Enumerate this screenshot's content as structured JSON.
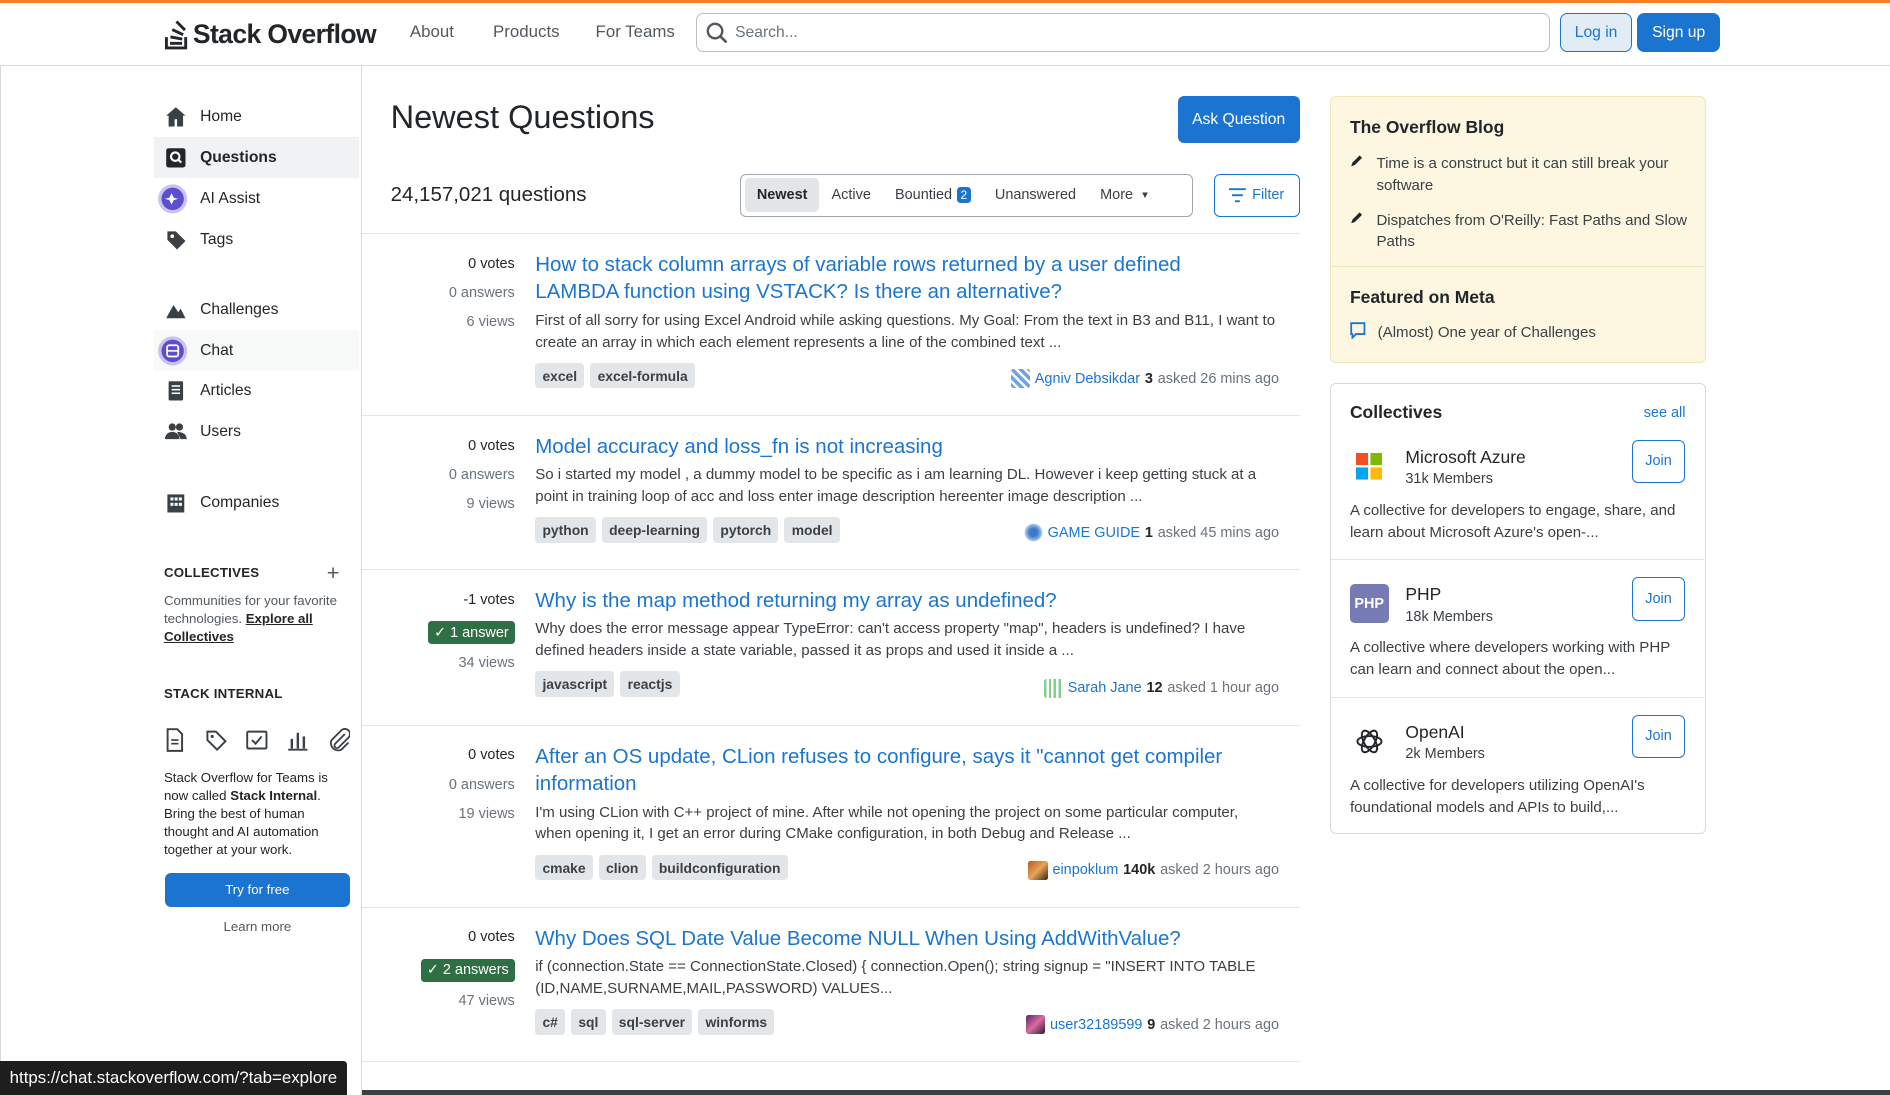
{
  "header": {
    "logo_text": "Stack Overflow",
    "nav": [
      "About",
      "Products",
      "For Teams"
    ],
    "search_placeholder": "Search...",
    "login": "Log in",
    "signup": "Sign up"
  },
  "sidebar": {
    "items": [
      {
        "label": "Home",
        "icon": "home-icon"
      },
      {
        "label": "Questions",
        "icon": "questions-icon"
      },
      {
        "label": "AI Assist",
        "icon": "ai-assist-icon"
      },
      {
        "label": "Tags",
        "icon": "tag-icon"
      },
      {
        "label": "Challenges",
        "icon": "challenges-icon"
      },
      {
        "label": "Chat",
        "icon": "chat-icon"
      },
      {
        "label": "Articles",
        "icon": "articles-icon"
      },
      {
        "label": "Users",
        "icon": "users-icon"
      },
      {
        "label": "Companies",
        "icon": "companies-icon"
      }
    ],
    "collectives_heading": "COLLECTIVES",
    "collectives_text": "Communities for your favorite technologies.",
    "collectives_link": "Explore all Collectives",
    "internal_heading": "STACK INTERNAL",
    "internal_text_1": "Stack Overflow for Teams is now called ",
    "internal_text_bold": "Stack Internal",
    "internal_text_2": ". Bring the best of human thought and AI automation together at your work.",
    "try_free": "Try for free",
    "learn_more": "Learn more"
  },
  "main": {
    "title": "Newest Questions",
    "ask_button": "Ask Question",
    "count": "24,157,021 questions",
    "tabs": {
      "newest": "Newest",
      "active": "Active",
      "bountied": "Bountied",
      "bountied_count": "2",
      "unanswered": "Unanswered",
      "more": "More"
    },
    "filter": "Filter"
  },
  "questions": [
    {
      "votes": "0 votes",
      "answers": "0 answers",
      "views": "6 views",
      "title": "How to stack column arrays of variable rows returned by a user defined LAMBDA function using VSTACK? Is there an alternative?",
      "excerpt": "First of all sorry for using Excel Android while asking questions. My Goal: From the text in B3 and B11, I want to create an array in which each element represents a line of the combined text ...",
      "tags": [
        "excel",
        "excel-formula"
      ],
      "user": "Agniv Debsikdar",
      "rep": "3",
      "time": "asked 26 mins ago"
    },
    {
      "votes": "0 votes",
      "answers": "0 answers",
      "views": "9 views",
      "title": "Model accuracy and loss_fn is not increasing",
      "excerpt": "So i started my model , a dummy model to be specific as i am learning DL. However i keep getting stuck at a point in training loop of acc and loss enter image description hereenter image description ...",
      "tags": [
        "python",
        "deep-learning",
        "pytorch",
        "model"
      ],
      "user": "GAME GUIDE",
      "rep": "1",
      "time": "asked 45 mins ago"
    },
    {
      "votes": "-1 votes",
      "answers": "1 answer",
      "views": "34 views",
      "title": "Why is the map method returning my array as undefined?",
      "excerpt": "Why does the error message appear TypeError: can't access property \"map\", headers is undefined? I have defined headers inside a state variable, passed it as props and used it inside a ...",
      "tags": [
        "javascript",
        "reactjs"
      ],
      "user": "Sarah Jane",
      "rep": "12",
      "time": "asked 1 hour ago"
    },
    {
      "votes": "0 votes",
      "answers": "0 answers",
      "views": "19 views",
      "title": "After an OS update, CLion refuses to configure, says it \"cannot get compiler information",
      "excerpt": "I'm using CLion with C++ project of mine. After while not opening the project on some particular com­puter, when opening it, I get an error during CMake configuration, in both Debug and Release ...",
      "tags": [
        "cmake",
        "clion",
        "buildconfiguration"
      ],
      "user": "einpoklum",
      "rep": "140k",
      "time": "asked 2 hours ago"
    },
    {
      "votes": "0 votes",
      "answers": "2 answers",
      "views": "47 views",
      "title": "Why Does SQL Date Value Become NULL When Using AddWithValue?",
      "excerpt": "if (connection.State == ConnectionState.Closed) { connection.Open(); string signup = \"INSERT INTO TABLE (ID,NAME,SURNAME,MAIL,PASSWORD) VALUES...",
      "tags": [
        "c#",
        "sql",
        "sql-server",
        "winforms"
      ],
      "user": "user32189599",
      "rep": "9",
      "time": "asked 2 hours ago"
    }
  ],
  "blog": {
    "heading": "The Overflow Blog",
    "items": [
      "Time is a construct but it can still break your software",
      "Dispatches from O'Reilly: Fast Paths and Slow Paths"
    ],
    "meta_heading": "Featured on Meta",
    "meta_items": [
      "(Almost) One year of Challenges"
    ]
  },
  "collectives": {
    "heading": "Collectives",
    "see_all": "see all",
    "items": [
      {
        "name": "Microsoft Azure",
        "members": "31k Members",
        "join": "Join",
        "desc": "A collective for developers to engage, share, and learn about Microsoft Azure's open-..."
      },
      {
        "name": "PHP",
        "members": "18k Members",
        "join": "Join",
        "desc": "A collective where developers working with PHP can learn and connect about the open..."
      },
      {
        "name": "OpenAI",
        "members": "2k Members",
        "join": "Join",
        "desc": "A collective for developers utilizing OpenAI's foundational models and APIs to build,..."
      }
    ]
  },
  "statusbar": {
    "url": "https://chat.stackoverflow.com/?tab=explore"
  },
  "colors": {
    "accent": "#1b75d0",
    "orange": "#f48225",
    "accepted": "#2f6f44",
    "blog_bg": "#fdf7e2"
  }
}
